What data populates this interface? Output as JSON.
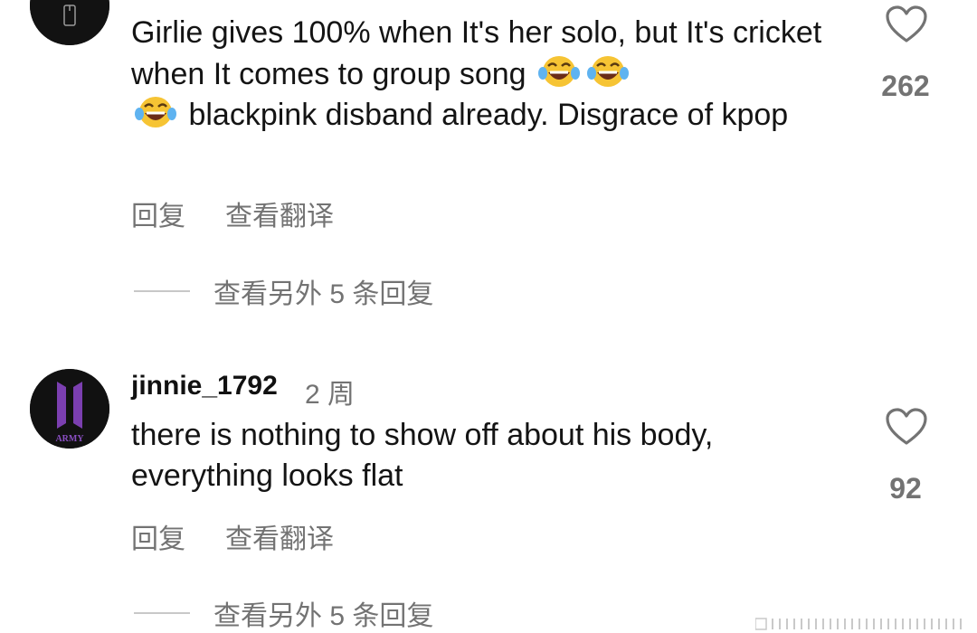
{
  "comments": [
    {
      "avatar_icon": "profile-avatar-icon",
      "text_part1": "Girlie gives 100% when It's her solo, but It's cricket when It comes to group song ",
      "emoji": "face-with-tears-of-joy",
      "text_part2": " blackpink disband already. Disgrace of kpop",
      "reply_label": "回复",
      "translate_label": "查看翻译",
      "view_more_label": "查看另外 5 条回复",
      "likes": "262"
    },
    {
      "username": "jinnie_1792",
      "time": "2 周",
      "avatar_icon": "army-logo-icon",
      "avatar_text": "ARMY",
      "text": "there is nothing to show off about his body, everything looks flat",
      "reply_label": "回复",
      "translate_label": "查看翻译",
      "view_more_label": "查看另外 5 条回复",
      "likes": "92"
    }
  ],
  "colors": {
    "text": "#141414",
    "secondary": "#737373",
    "army_purple": "#7b3fb0"
  }
}
